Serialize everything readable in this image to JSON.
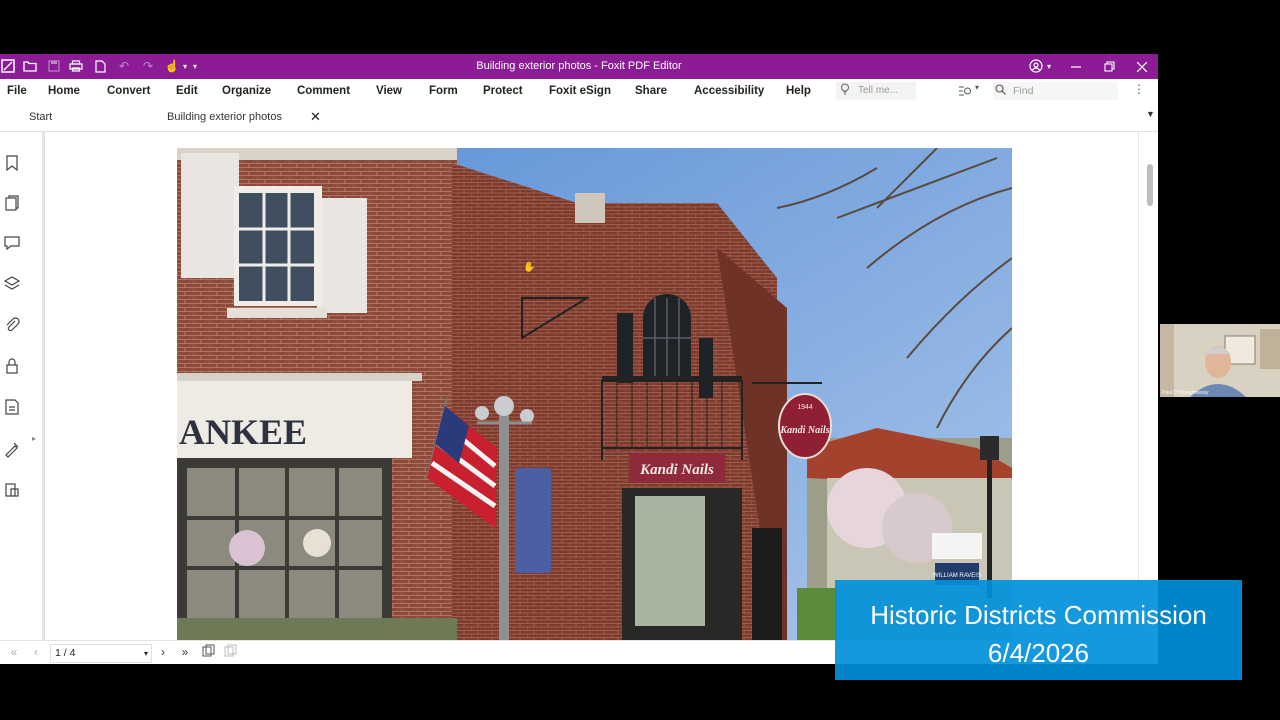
{
  "window": {
    "title": "Building exterior photos - Foxit PDF Editor"
  },
  "menu": [
    "File",
    "Home",
    "Convert",
    "Edit",
    "Organize",
    "Comment",
    "View",
    "Form",
    "Protect",
    "Foxit eSign",
    "Share",
    "Accessibility",
    "Help"
  ],
  "tell_me_placeholder": "Tell me...",
  "find_placeholder": "Find",
  "tabs": {
    "start": "Start",
    "document": "Building exterior photos"
  },
  "photo_text": {
    "store_sign": "ANKEE",
    "salon_sign": "Kandi Nails",
    "hanging_sign": "Kandi Nails",
    "hanging_year": "1944",
    "realty_sign": "WILLIAM RAVEIS"
  },
  "page_nav": {
    "current": "1 / 4"
  },
  "webcam": {
    "participant": "Paul O'Shaughnessy"
  },
  "caption": {
    "line1": "Historic Districts Commission",
    "line2": "6/4/2026"
  },
  "colors": {
    "titlebar": "#8b1c96",
    "caption_bg": "#0090dc"
  }
}
